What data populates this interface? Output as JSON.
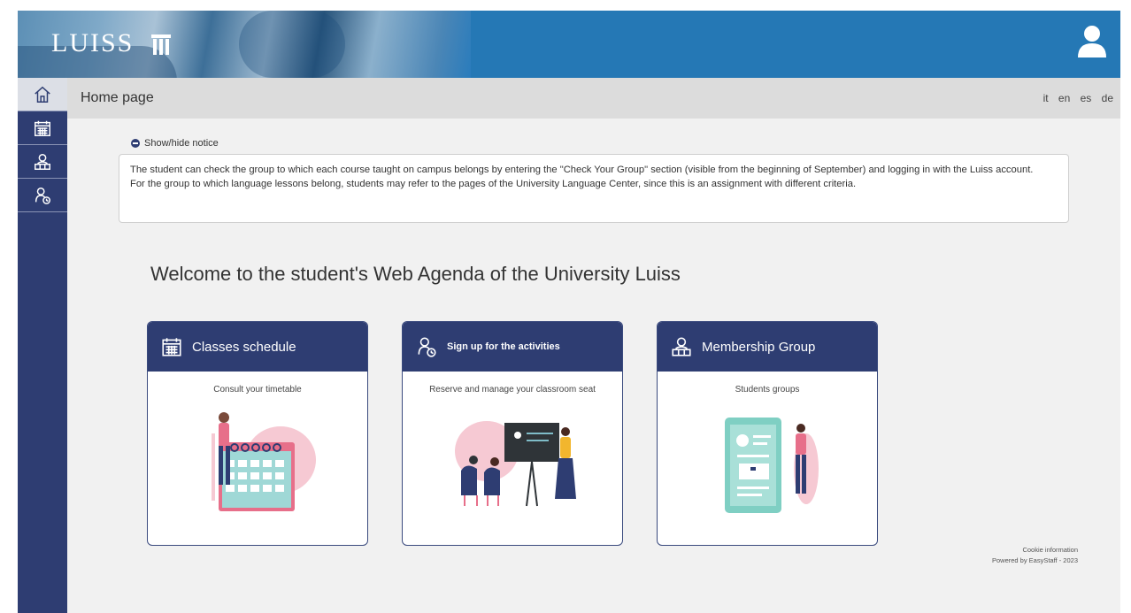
{
  "header": {
    "logo_text": "LUISS"
  },
  "topbar": {
    "title": "Home page",
    "languages": [
      "it",
      "en",
      "es",
      "de"
    ]
  },
  "notice": {
    "toggle_label": "Show/hide notice",
    "paragraphs": [
      "The student can check the group to which each course taught on campus belongs by entering the \"Check Your Group\" section (visible from the beginning of September) and logging in with the Luiss account.",
      "For the group to which language lessons belong, students may refer to the pages of the University Language Center, since this is an assignment with different criteria."
    ]
  },
  "welcome": "Welcome to the student's Web Agenda of the University Luiss",
  "cards": [
    {
      "title": "Classes schedule",
      "subtitle": "Consult your timetable",
      "icon": "calendar-icon"
    },
    {
      "title": "Sign up for the activities",
      "subtitle": "Reserve and manage your classroom seat",
      "icon": "activities-icon"
    },
    {
      "title": "Membership Group",
      "subtitle": "Students groups",
      "icon": "group-icon"
    }
  ],
  "footer": {
    "cookie": "Cookie information",
    "powered": "Powered by EasyStaff - 2023"
  },
  "colors": {
    "banner": "#2578b5",
    "navy": "#2e3d72",
    "topbar": "#dcdcdc",
    "content_bg": "#f1f1f1"
  }
}
